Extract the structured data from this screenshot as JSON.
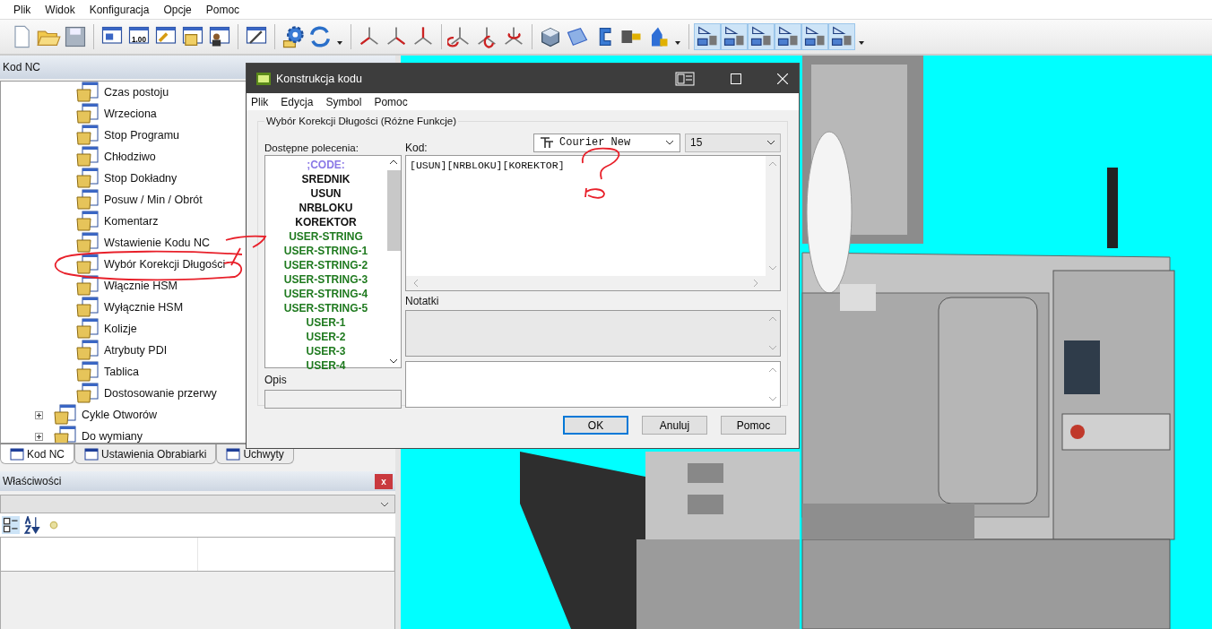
{
  "menu": [
    "Plik",
    "Widok",
    "Konfiguracja",
    "Opcje",
    "Pomoc"
  ],
  "toolbar": {
    "value_icon_text": "1.00"
  },
  "nc_panel": {
    "title": "Kod NC",
    "tree": [
      {
        "children": [
          {
            "label": "Czas postoju"
          },
          {
            "label": "Wrzeciona"
          },
          {
            "label": "Stop Programu"
          },
          {
            "label": "Chłodziwo"
          },
          {
            "label": "Stop Dokładny"
          },
          {
            "label": "Posuw / Min / Obrót"
          },
          {
            "label": "Komentarz"
          },
          {
            "label": "Wstawienie Kodu NC"
          },
          {
            "label": "Wybór Korekcji Długości"
          },
          {
            "label": "Włącznie HSM"
          },
          {
            "label": "Wyłącznie HSM"
          },
          {
            "label": "Kolizje"
          },
          {
            "label": "Atrybuty PDI"
          },
          {
            "label": "Tablica"
          },
          {
            "label": "Dostosowanie przerwy"
          }
        ]
      },
      {
        "label": "Cykle Otworów",
        "expanded": false
      },
      {
        "label": "Do wymiany",
        "expanded": false
      }
    ],
    "tabs": [
      {
        "label": "Kod NC",
        "selected": true
      },
      {
        "label": "Ustawienia Obrabiarki",
        "selected": false
      },
      {
        "label": "Uchwyty",
        "selected": false
      }
    ]
  },
  "properties_panel": {
    "title": "Właściwości",
    "close": "x"
  },
  "dialog": {
    "title": "Konstrukcja kodu",
    "menu": [
      "Plik",
      "Edycja",
      "Symbol",
      "Pomoc"
    ],
    "group_title": "Wybór Korekcji Długości (Różne Funkcje)",
    "commands_label": "Dostępne polecenia:",
    "commands": [
      {
        "text": ";CODE:",
        "color": "#8a78e6"
      },
      {
        "text": "SREDNIK",
        "color": "#111111"
      },
      {
        "text": "USUN",
        "color": "#111111"
      },
      {
        "text": "NRBLOKU",
        "color": "#111111"
      },
      {
        "text": "KOREKTOR",
        "color": "#111111"
      },
      {
        "text": "USER-STRING",
        "color": "#1f7a1f"
      },
      {
        "text": "USER-STRING-1",
        "color": "#1f7a1f"
      },
      {
        "text": "USER-STRING-2",
        "color": "#1f7a1f"
      },
      {
        "text": "USER-STRING-3",
        "color": "#1f7a1f"
      },
      {
        "text": "USER-STRING-4",
        "color": "#1f7a1f"
      },
      {
        "text": "USER-STRING-5",
        "color": "#1f7a1f"
      },
      {
        "text": "USER-1",
        "color": "#1f7a1f"
      },
      {
        "text": "USER-2",
        "color": "#1f7a1f"
      },
      {
        "text": "USER-3",
        "color": "#1f7a1f"
      },
      {
        "text": "USER-4",
        "color": "#1f7a1f"
      }
    ],
    "description_label": "Opis",
    "code_label": "Kod:",
    "font": "Courier New",
    "font_size": "15",
    "code": "[USUN][NRBLOKU][KOREKTOR]",
    "notes_label": "Notatki",
    "buttons": [
      {
        "label": "OK",
        "default": true
      },
      {
        "label": "Anuluj",
        "default": false
      },
      {
        "label": "Pomoc",
        "default": false
      }
    ]
  }
}
